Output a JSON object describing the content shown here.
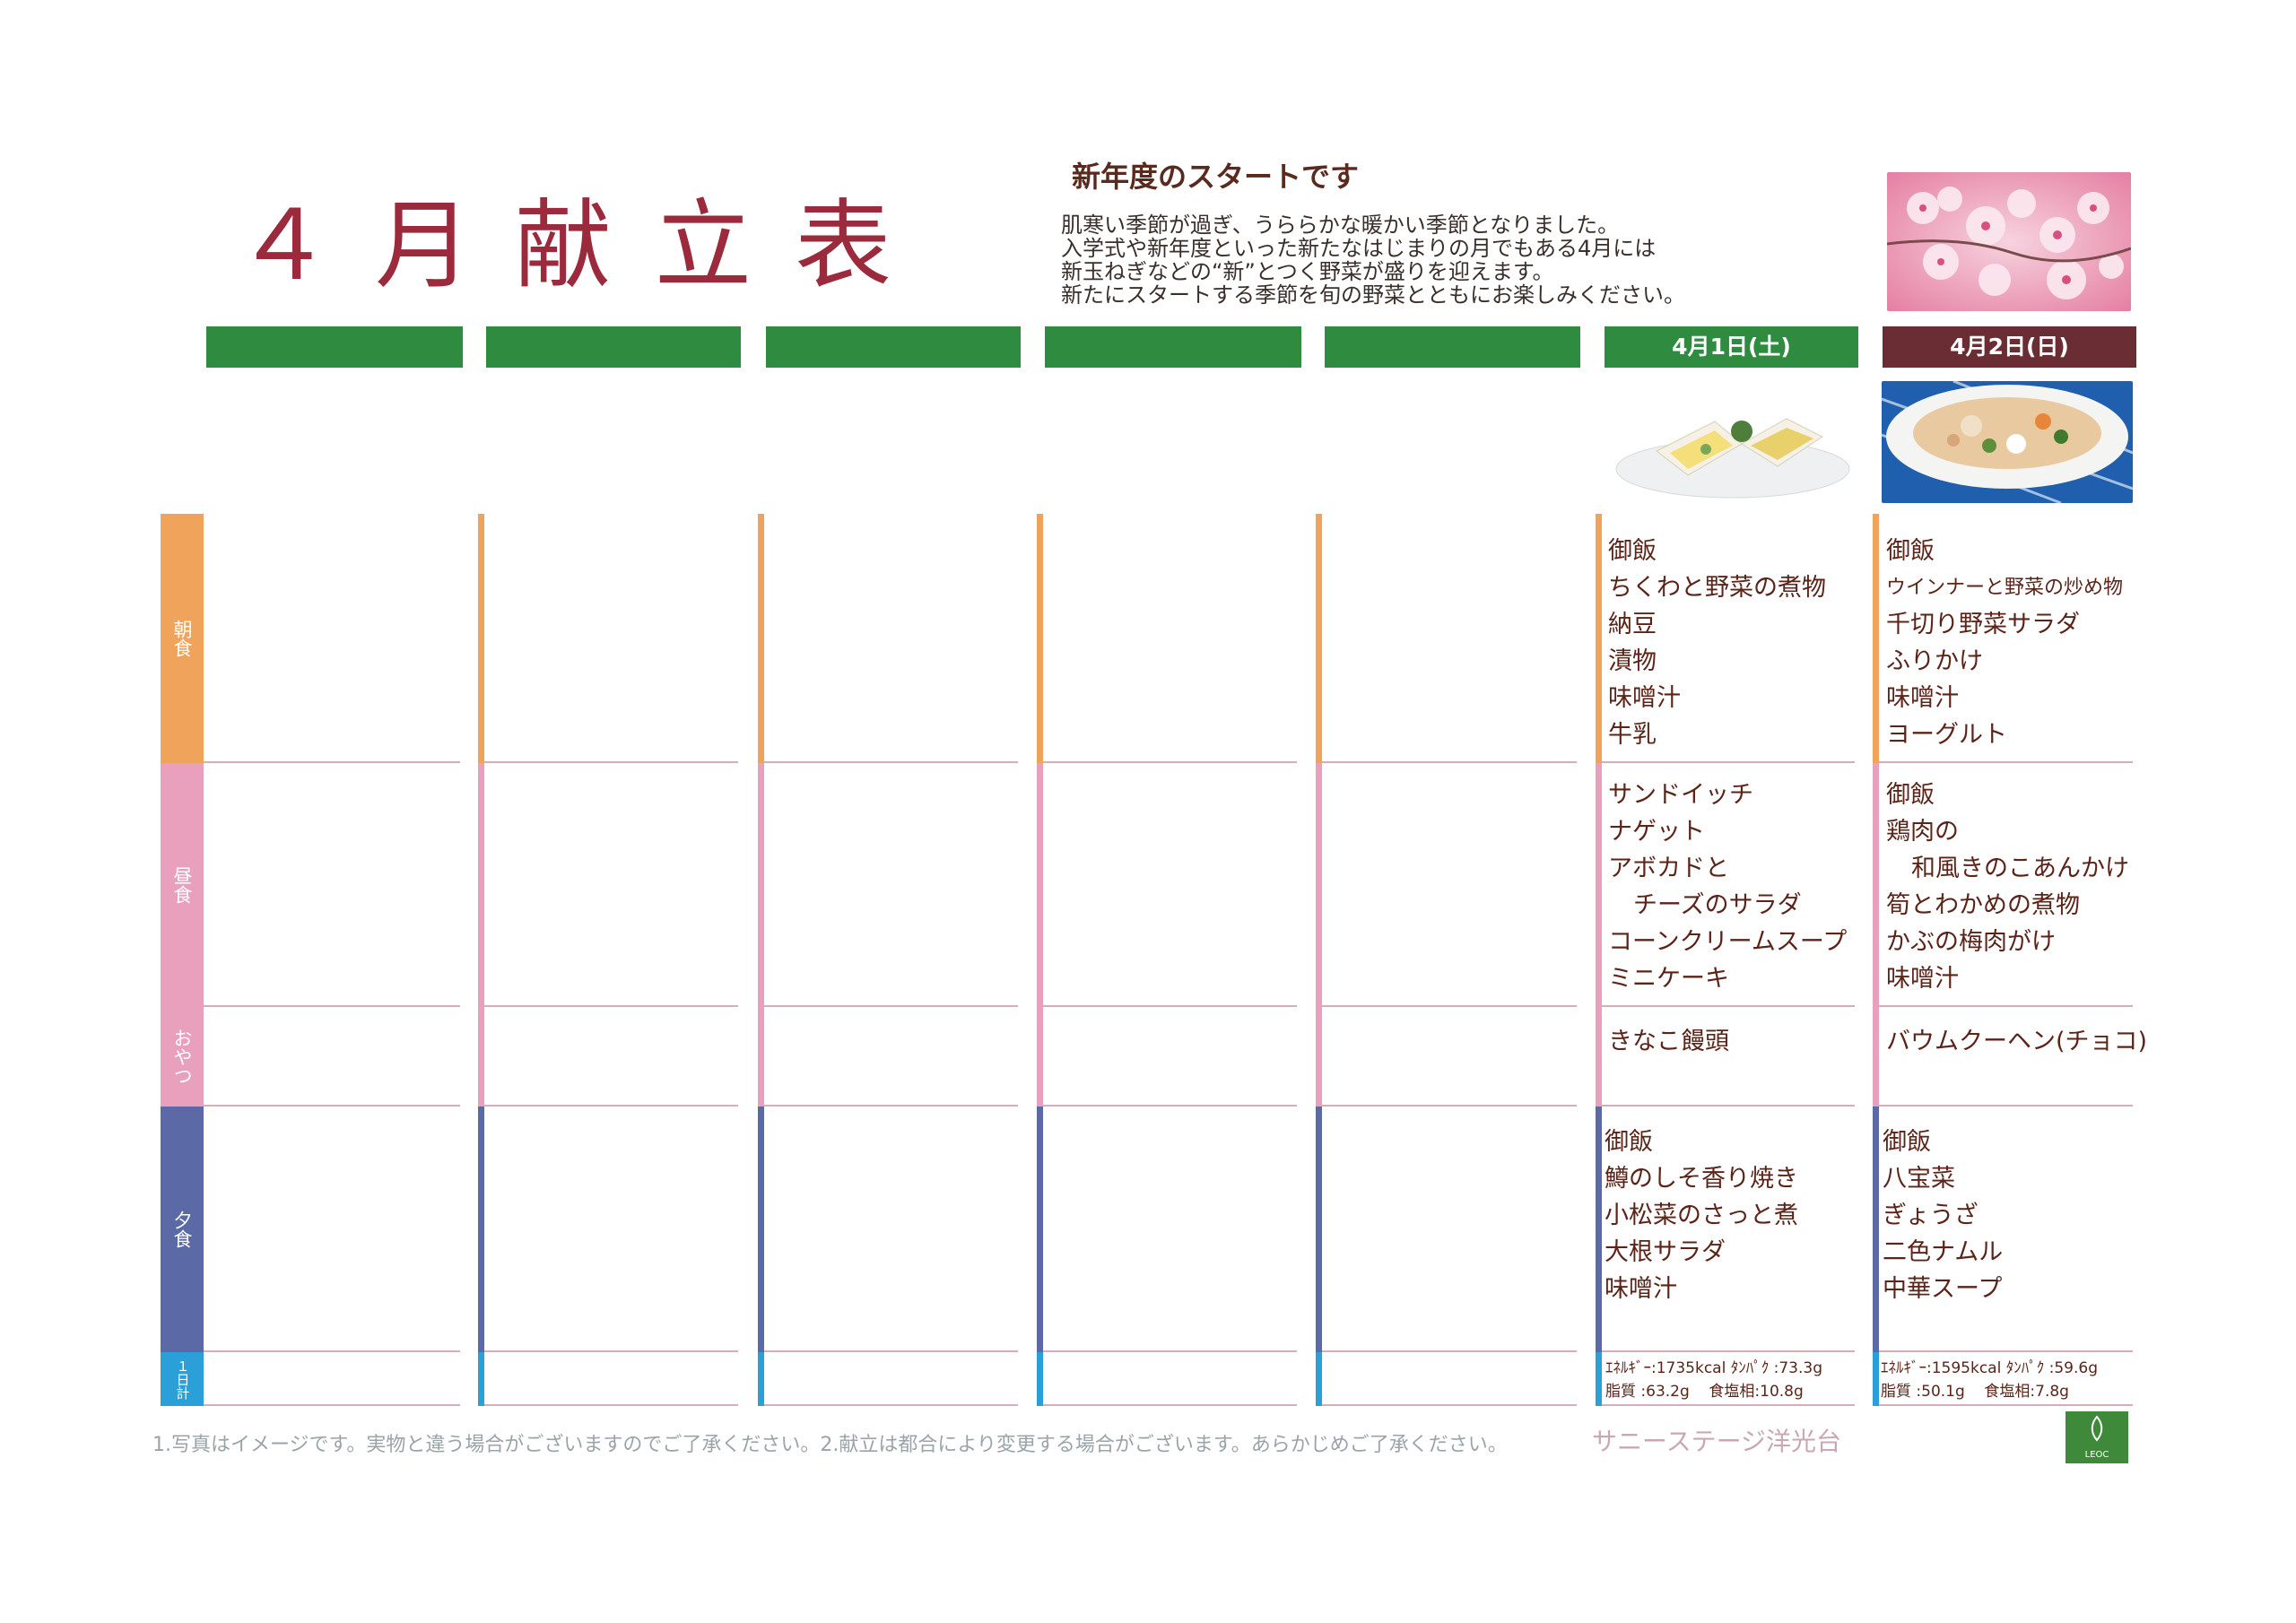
{
  "header": {
    "title": "４月献立表",
    "intro_heading": "新年度のスタートです",
    "intro_lines": [
      "肌寒い季節が過ぎ、うららかな暖かい季節となりました。",
      "入学式や新年度といった新たなはじまりの月でもある4月には",
      "新玉ねぎなどの“新”とつく野菜が盛りを迎えます。",
      "新たにスタートする季節を旬の野菜とともにお楽しみください。"
    ]
  },
  "meal_labels": {
    "breakfast": "朝食",
    "lunch": "昼食",
    "snack": "おやつ",
    "dinner": "夕食",
    "daily_total": "１日計"
  },
  "days": [
    {
      "date_label": "4月1日(土)",
      "breakfast": [
        "御飯",
        "ちくわと野菜の煮物",
        "納豆",
        "漬物",
        "味噌汁",
        "牛乳"
      ],
      "lunch": [
        "サンドイッチ",
        "ナゲット",
        "アボカドと",
        "チーズのサラダ",
        "コーンクリームスープ",
        "ミニケーキ"
      ],
      "snack": [
        "きなこ饅頭"
      ],
      "dinner": [
        "御飯",
        "鱒のしそ香り焼き",
        "小松菜のさっと煮",
        "大根サラダ",
        "味噌汁"
      ],
      "nutrition": {
        "energy": "ｴﾈﾙｷﾞｰ:1735kcal",
        "protein": "ﾀﾝﾊﾟｸ :73.3g",
        "fat": "脂質 :63.2g",
        "salt": "食塩相:10.8g"
      }
    },
    {
      "date_label": "4月2日(日)",
      "breakfast": [
        "御飯",
        "ウインナーと野菜の炒め物",
        "千切り野菜サラダ",
        "ふりかけ",
        "味噌汁",
        "ヨーグルト"
      ],
      "lunch": [
        "御飯",
        "鶏肉の",
        "和風きのこあんかけ",
        "筍とわかめの煮物",
        "かぶの梅肉がけ",
        "味噌汁"
      ],
      "snack": [
        "バウムクーヘン(チョコ)"
      ],
      "dinner": [
        "御飯",
        "八宝菜",
        "ぎょうざ",
        "二色ナムル",
        "中華スープ"
      ],
      "nutrition": {
        "energy": "ｴﾈﾙｷﾞｰ:1595kcal",
        "protein": "ﾀﾝﾊﾟｸ :59.6g",
        "fat": "脂質 :50.1g",
        "salt": "食塩相:7.8g"
      }
    }
  ],
  "footer": {
    "note": "1.写真はイメージです。実物と違う場合がございますのでご了承ください。2.献立は都合により変更する場合がございます。あらかじめご了承ください。",
    "facility": "サニーステージ洋光台",
    "logo_text": "LEOC"
  },
  "colors": {
    "header_green": "#2e8b3f",
    "header_sunday": "#6b2d34",
    "breakfast": "#f0a35a",
    "lunch": "#e9a0bd",
    "dinner": "#5b6aa7",
    "daily_total": "#2a9fd8",
    "title": "#9b2a3c",
    "menu_text": "#5c2419"
  }
}
